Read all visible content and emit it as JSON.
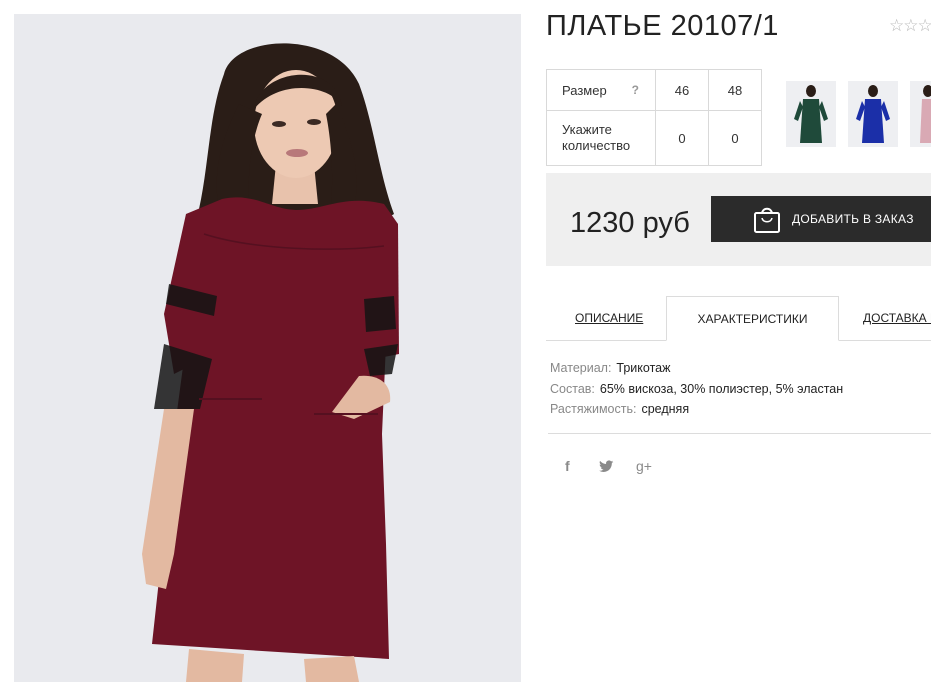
{
  "product": {
    "title": "ПЛАТЬЕ 20107/1",
    "rating_stars": "☆☆☆"
  },
  "size_table": {
    "size_label": "Размер",
    "size_help": "?",
    "sizes": [
      "46",
      "48"
    ],
    "qty_label": "Укажите количество",
    "quantities": [
      "0",
      "0"
    ]
  },
  "thumbnails": [
    {
      "name": "dark green dress",
      "color": "#1f4a3a"
    },
    {
      "name": "blue dress",
      "color": "#1b2fa8"
    },
    {
      "name": "pink dress",
      "color": "#d9a9b4"
    }
  ],
  "price": {
    "value": "1230 руб",
    "add_button_label": "ДОБАВИТЬ В ЗАКАЗ"
  },
  "tabs": [
    {
      "label": "ОПИСАНИЕ",
      "active": false
    },
    {
      "label": "ХАРАКТЕРИСТИКИ",
      "active": true
    },
    {
      "label": "ДОСТАВКА И",
      "active": false
    }
  ],
  "specs": [
    {
      "key": "Материал:",
      "value": "Трикотаж"
    },
    {
      "key": "Состав:",
      "value": "65% вискоза, 30% полиэстер, 5% эластан"
    },
    {
      "key": "Растяжимость:",
      "value": "средняя"
    }
  ],
  "social": {
    "facebook": "f",
    "twitter": "twitter",
    "google_plus": "g+"
  },
  "colors": {
    "dress": "#6e1426",
    "lace": "#141414",
    "button": "#2b2b2b",
    "price_bg": "#efefef"
  }
}
